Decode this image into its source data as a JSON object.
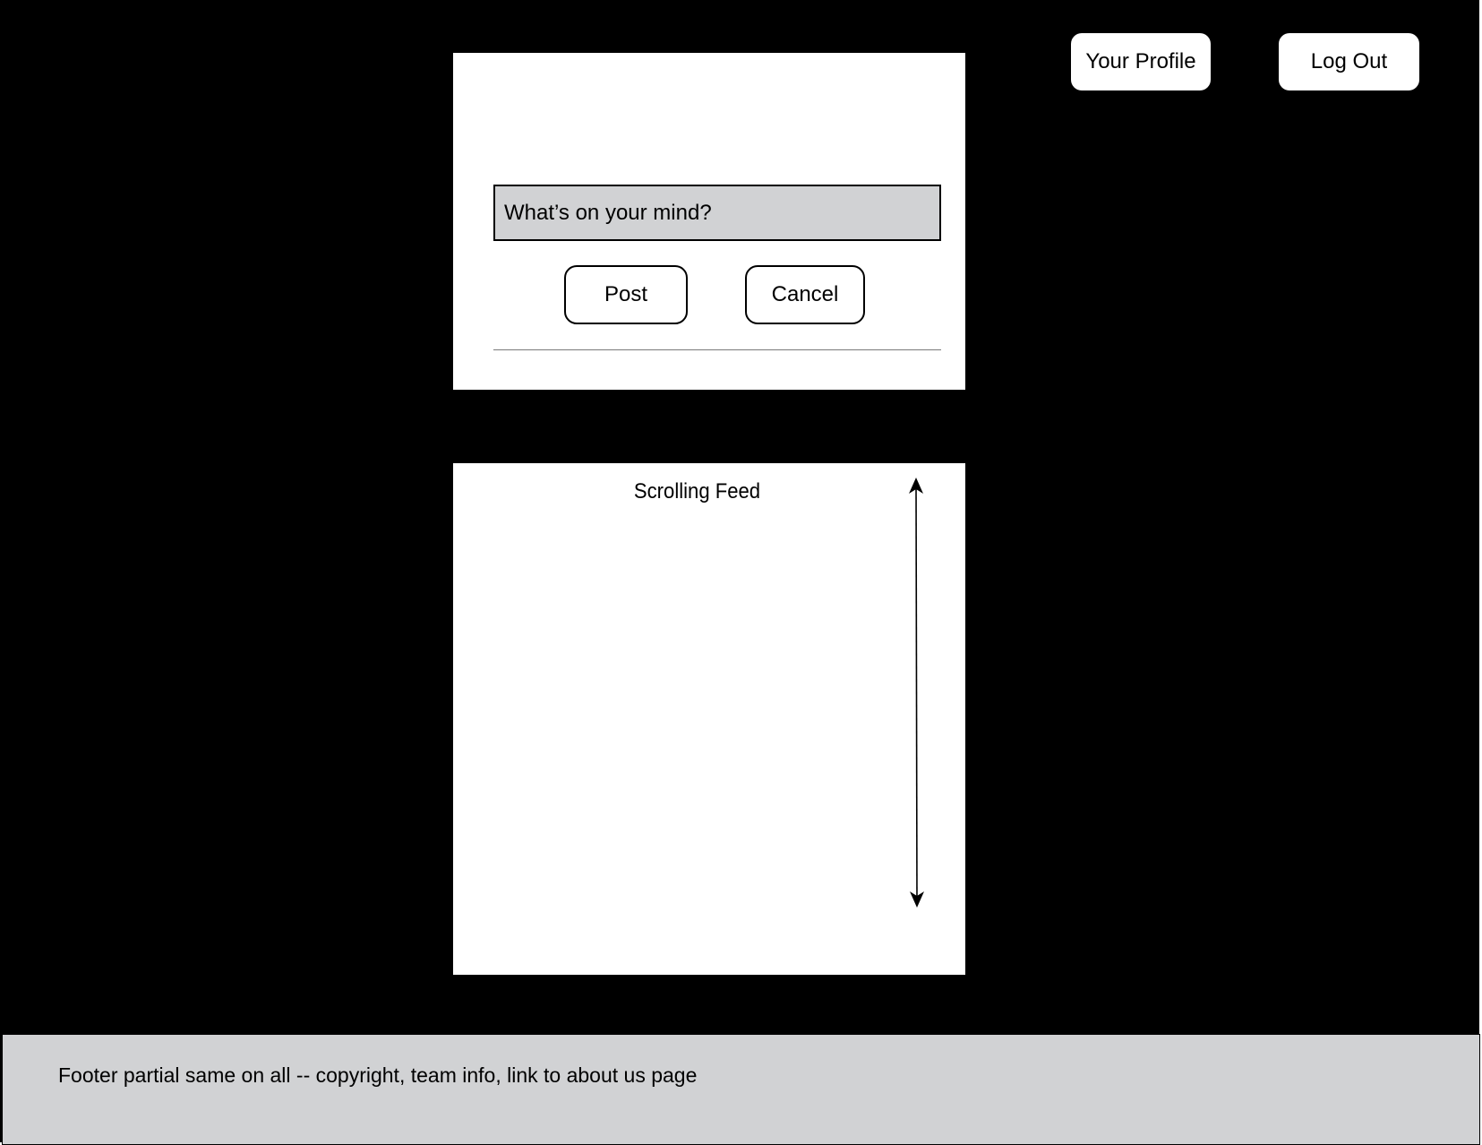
{
  "header": {
    "profile_label": "Your Profile",
    "logout_label": "Log Out"
  },
  "composer": {
    "placeholder": "What’s on your mind?",
    "post_label": "Post",
    "cancel_label": "Cancel"
  },
  "feed": {
    "title": "Scrolling Feed"
  },
  "footer": {
    "text": "Footer partial same on all -- copyright, team info, link to about us page"
  },
  "colors": {
    "background": "#000000",
    "panel": "#ffffff",
    "input_fill": "#d1d2d4",
    "footer_fill": "#d1d2d4"
  }
}
